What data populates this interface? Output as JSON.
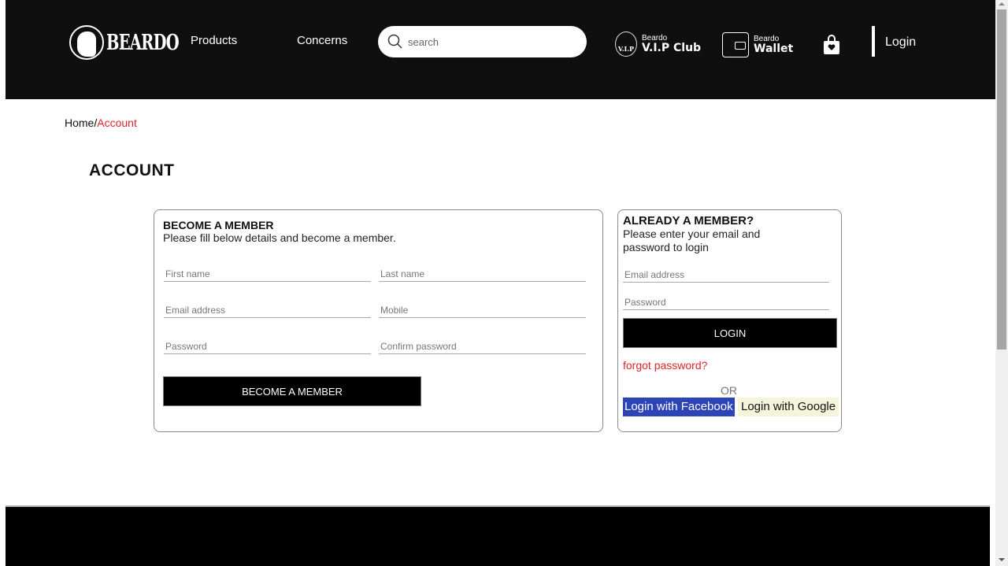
{
  "header": {
    "logo_text": "BEARDO",
    "nav": [
      {
        "label": "Products"
      },
      {
        "label": "Concerns"
      }
    ],
    "search": {
      "placeholder": "search",
      "value": ""
    },
    "vip": {
      "badge": "V.I.P",
      "small": "Beardo",
      "big": "V.I.P Club"
    },
    "wallet": {
      "small": "Beardo",
      "big": "Wallet"
    },
    "login_label": "Login"
  },
  "breadcrumb": {
    "home": "Home",
    "separator": "/",
    "current": "Account"
  },
  "page_title": "ACCOUNT",
  "signup": {
    "title": "BECOME A MEMBER",
    "subtitle": "Please fill below details and become a member.",
    "fields": {
      "first_name": {
        "placeholder": "First name",
        "value": ""
      },
      "last_name": {
        "placeholder": "Last name",
        "value": ""
      },
      "email": {
        "placeholder": "Email address",
        "value": ""
      },
      "mobile": {
        "placeholder": "Mobile",
        "value": ""
      },
      "password": {
        "placeholder": "Password",
        "value": ""
      },
      "confirm_password": {
        "placeholder": "Confirm password",
        "value": ""
      }
    },
    "submit_label": "BECOME A MEMBER"
  },
  "login": {
    "title": "ALREADY A MEMBER?",
    "subtitle": "Please enter your email and password to login",
    "fields": {
      "email": {
        "placeholder": "Email address",
        "value": ""
      },
      "password": {
        "placeholder": "Password",
        "value": ""
      }
    },
    "submit_label": "LOGIN",
    "forgot_label": "forgot password?",
    "or_label": "OR",
    "facebook_label": "Login with Facebook",
    "google_label": "Login with Google"
  },
  "colors": {
    "accent_red": "#e02424",
    "facebook_blue": "#2c44b8",
    "google_bg": "#f5f5dc",
    "header_bg": "#0f0f0f"
  }
}
